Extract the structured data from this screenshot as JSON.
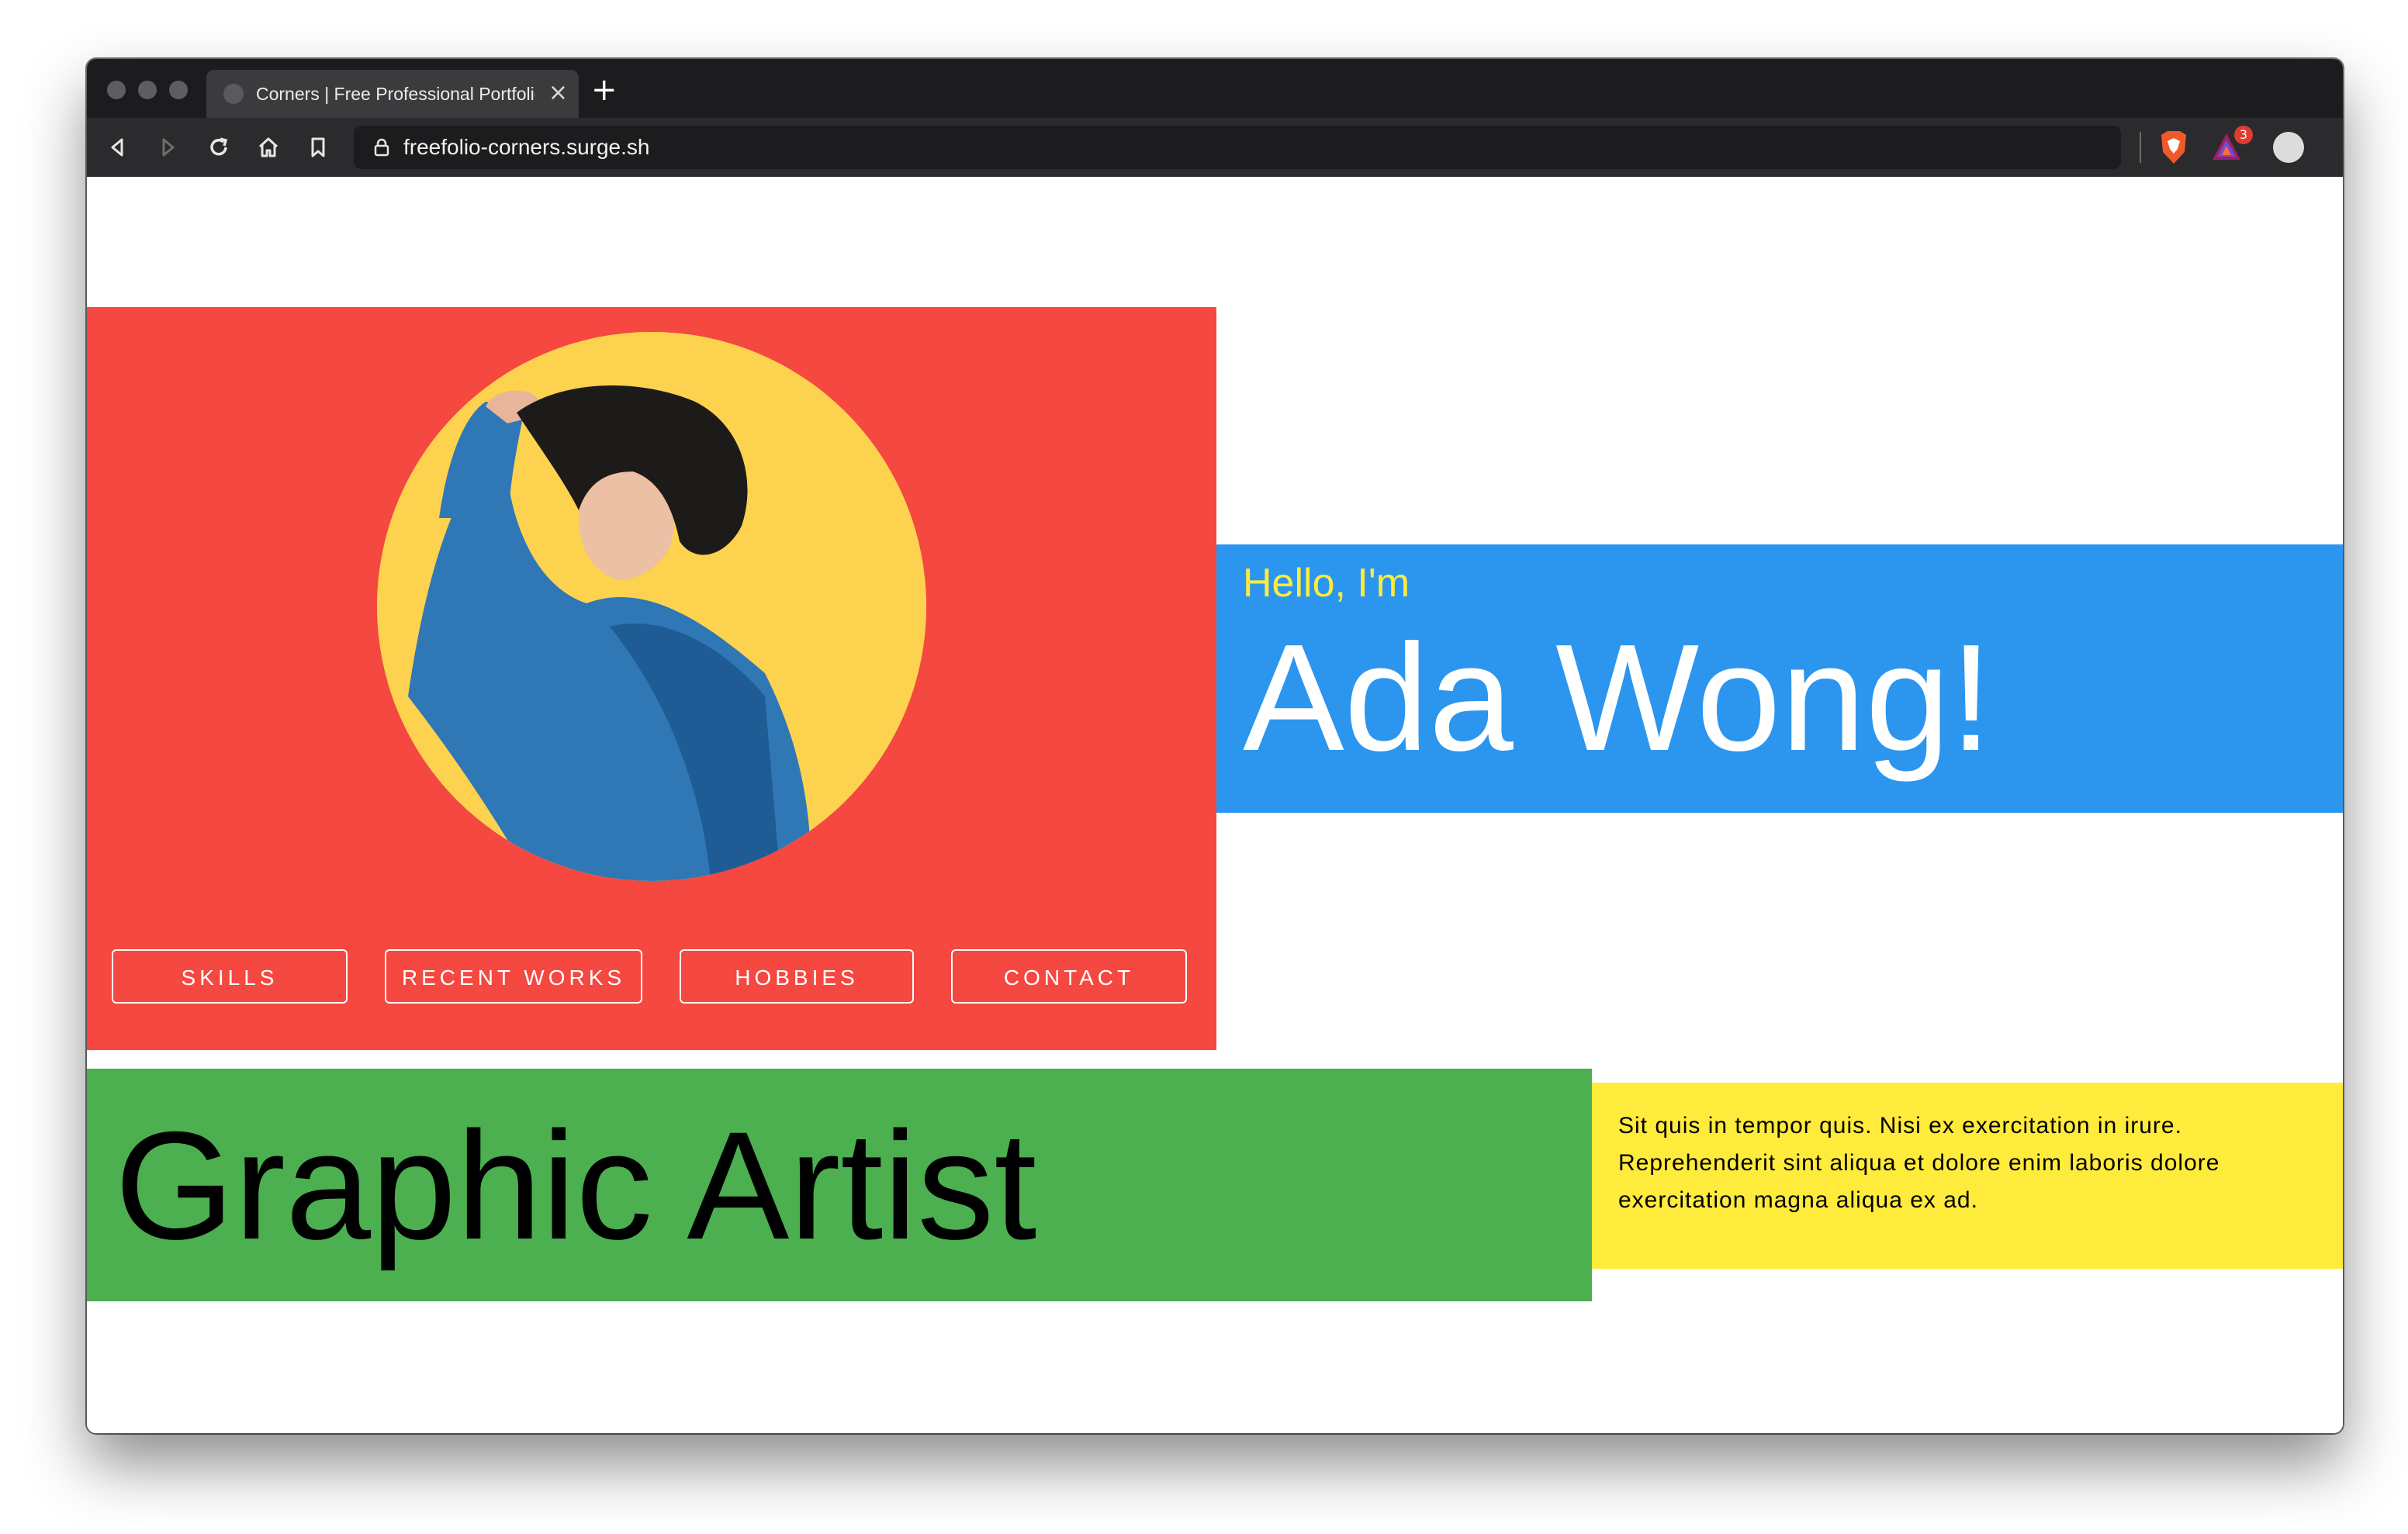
{
  "browser": {
    "tab_title": "Corners | Free Professional Portfolio",
    "url": "freefolio-corners.surge.sh",
    "rewards_badge": "3"
  },
  "hero": {
    "greeting": "Hello, I'm",
    "name": "Ada Wong!",
    "role": "Graphic Artist",
    "about": "Sit quis in tempor quis. Nisi ex exercitation in irure. Reprehenderit sint aliqua et dolore enim laboris dolore exercitation magna aliqua ex ad."
  },
  "nav": {
    "items": [
      "SKILLS",
      "RECENT WORKS",
      "HOBBIES",
      "CONTACT"
    ]
  },
  "colors": {
    "red": "#f44840",
    "blue": "#2c96ef",
    "green": "#4caf50",
    "yellow": "#ffeb3b"
  }
}
